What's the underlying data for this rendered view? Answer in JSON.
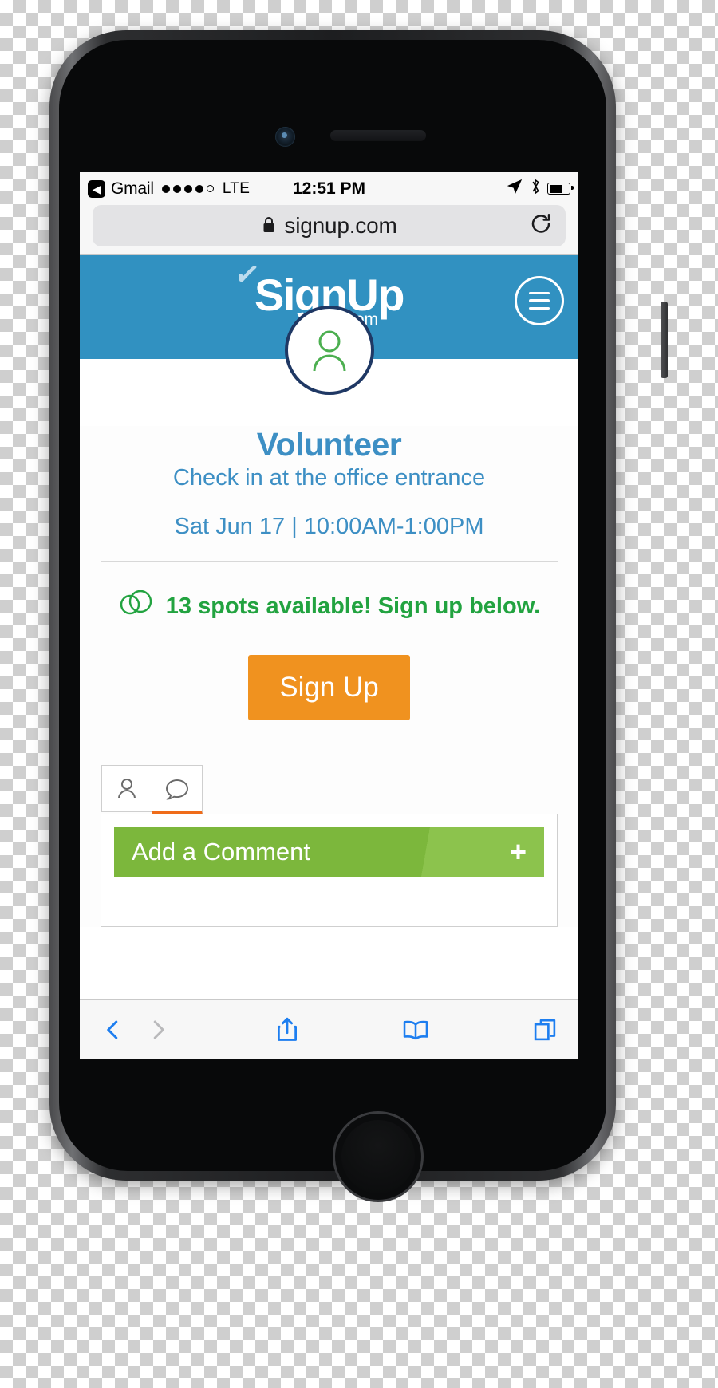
{
  "statusbar": {
    "back_icon": "back-chevron-icon",
    "carrier_app": "Gmail",
    "signal_dots_filled": 4,
    "signal_dots_total": 5,
    "network": "LTE",
    "time": "12:51 PM",
    "location_icon": "location-arrow-icon",
    "bluetooth_icon": "bluetooth-icon",
    "battery_icon": "battery-icon",
    "battery_level_pct": 62
  },
  "browser": {
    "lock_icon": "lock-icon",
    "url": "signup.com",
    "reload_icon": "reload-icon",
    "toolbar": {
      "back_label": "back-icon",
      "forward_label": "forward-icon",
      "share_label": "share-icon",
      "bookmarks_label": "bookmarks-icon",
      "tabs_label": "tabs-icon"
    }
  },
  "header": {
    "logo_text": "SignUp",
    "logo_suffix": ".com",
    "check_glyph": "✓",
    "menu_icon": "hamburger-menu-icon",
    "bg_color": "#3191c1"
  },
  "avatar": {
    "icon": "person-icon",
    "border_color": "#1f3864",
    "icon_color": "#4caf50"
  },
  "event": {
    "title": "Volunteer",
    "subtitle": "Check in at the office entrance",
    "datetime": "Sat Jun 17 | 10:00AM-1:00PM",
    "title_color": "#3d8fc4"
  },
  "availability": {
    "icon": "spots-circles-icon",
    "message": "13 spots available! Sign up below.",
    "spots_count": 13,
    "color": "#22a340"
  },
  "signup_button": {
    "label": "Sign Up",
    "color": "#f0921f"
  },
  "tabs": [
    {
      "name": "participants",
      "icon": "person-icon",
      "active": false
    },
    {
      "name": "comments",
      "icon": "comment-bubble-icon",
      "active": true
    }
  ],
  "comment_panel": {
    "add_label": "Add a Comment",
    "plus": "+",
    "color": "#7cb73c"
  }
}
